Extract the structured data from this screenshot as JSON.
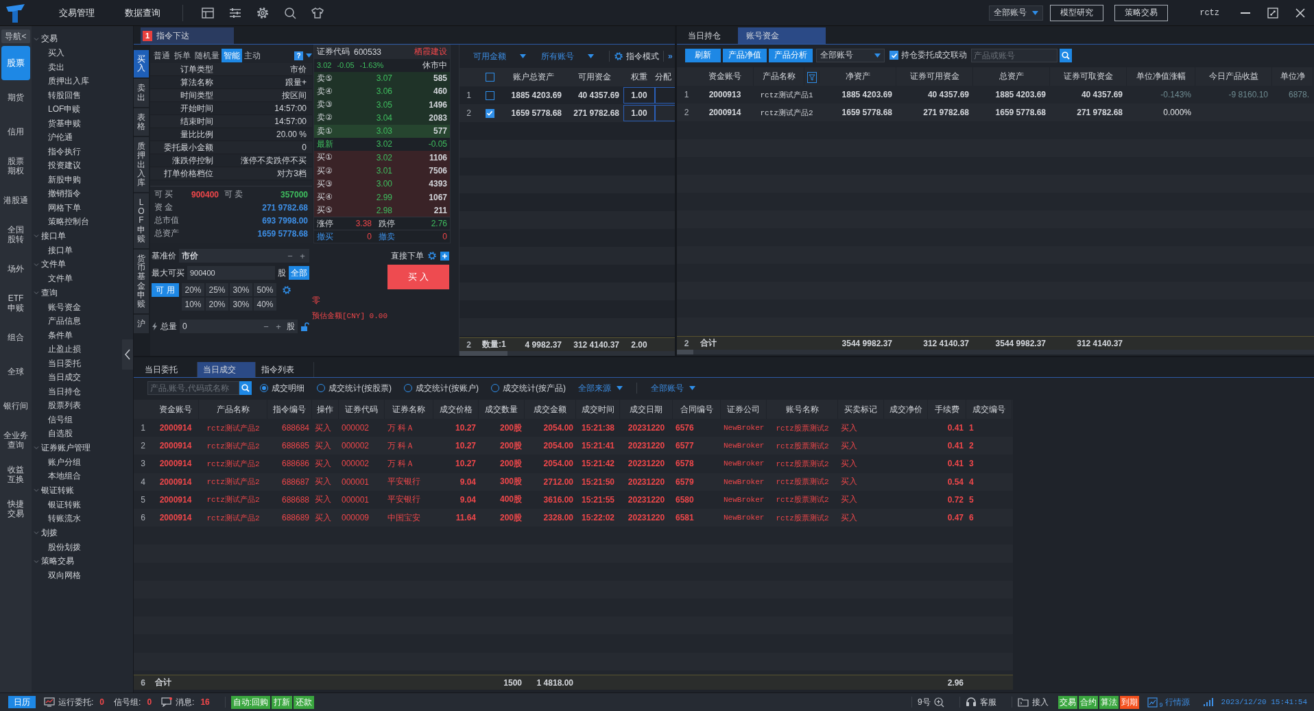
{
  "topbar": {
    "menus": [
      "交易管理",
      "数据查询"
    ],
    "account_filter": "全部账号",
    "buttons": [
      "模型研究",
      "策略交易"
    ],
    "user": "rctz"
  },
  "rail": {
    "toggle": "导航<",
    "items": [
      {
        "lines": [
          "股票"
        ],
        "selected": true
      },
      {
        "lines": [
          "期货"
        ],
        "selected": false
      },
      {
        "lines": [
          "信用"
        ],
        "selected": false
      },
      {
        "lines": [
          "股票",
          "期权"
        ],
        "selected": false
      },
      {
        "lines": [
          "港股通"
        ],
        "selected": false
      },
      {
        "lines": [
          "全国",
          "股转"
        ],
        "selected": false
      },
      {
        "lines": [
          "场外"
        ],
        "selected": false
      },
      {
        "lines": [
          "ETF",
          "申赎"
        ],
        "selected": false
      },
      {
        "lines": [
          "组合"
        ],
        "selected": false
      },
      {
        "lines": [
          "全球"
        ],
        "selected": false
      },
      {
        "lines": [
          "银行间"
        ],
        "selected": false
      },
      {
        "lines": [
          "全业务",
          "查询"
        ],
        "selected": false
      },
      {
        "lines": [
          "收益",
          "互换"
        ],
        "selected": false
      },
      {
        "lines": [
          "快捷",
          "交易"
        ],
        "selected": false
      }
    ]
  },
  "nav": {
    "groups": [
      {
        "label": "交易",
        "expanded": true,
        "children": [
          "买入",
          "卖出",
          "质押出入库",
          "转股回售",
          "LOF申赎",
          "货基申赎",
          "沪伦通",
          "指令执行",
          "投资建议",
          "新股申购",
          "撤销指令",
          "网格下单",
          "策略控制台"
        ]
      },
      {
        "label": "接口单",
        "expanded": true,
        "children": [
          "接口单"
        ]
      },
      {
        "label": "文件单",
        "expanded": true,
        "children": [
          "文件单"
        ]
      },
      {
        "label": "查询",
        "expanded": true,
        "children": [
          "账号资金",
          "产品信息",
          "条件单",
          "止盈止损",
          "当日委托",
          "当日成交",
          "当日持仓",
          "股票列表",
          "信号组",
          "自选股"
        ]
      },
      {
        "label": "证券账户管理",
        "expanded": true,
        "children": [
          "账户分组",
          "本地组合"
        ]
      },
      {
        "label": "银证转账",
        "expanded": true,
        "children": [
          "银证转账",
          "转账流水"
        ]
      },
      {
        "label": "划拨",
        "expanded": true,
        "children": [
          "股份划拨"
        ]
      },
      {
        "label": "策略交易",
        "expanded": true,
        "children": [
          "双向网格"
        ]
      }
    ]
  },
  "order": {
    "tab_badge": "1",
    "tab_title": "指令下达",
    "side_tabs": [
      {
        "label": "买入",
        "selected": true
      },
      {
        "label": "卖出",
        "selected": false
      },
      {
        "label": "表格",
        "selected": false
      },
      {
        "label": "质押出入库",
        "selected": false
      },
      {
        "label": "LOF申赎",
        "selected": false
      },
      {
        "label": "货币基金申赎",
        "selected": false
      },
      {
        "label": "沪",
        "selected": false
      }
    ],
    "mode_tabs": [
      {
        "label": "普通",
        "selected": false
      },
      {
        "label": "拆单",
        "selected": false
      },
      {
        "label": "随机量",
        "selected": false
      },
      {
        "label": "智能",
        "selected": true
      },
      {
        "label": "主动",
        "selected": false
      }
    ],
    "help": "?",
    "params": [
      {
        "label": "订单类型",
        "value": "市价"
      },
      {
        "label": "算法名称",
        "value": "跟量+"
      },
      {
        "label": "时间类型",
        "value": "按区间"
      },
      {
        "label": "开始时间",
        "value": "14:57:00"
      },
      {
        "label": "结束时间",
        "value": "14:57:00"
      },
      {
        "label": "量比比例",
        "value": "20.00 %"
      },
      {
        "label": "委托最小金额",
        "value": "0"
      },
      {
        "label": "涨跌停控制",
        "value": "涨停不卖跌停不买"
      },
      {
        "label": "打单价格档位",
        "value": "对方3档"
      }
    ],
    "can_buy": {
      "label": "可 买",
      "value": "900400"
    },
    "can_sell": {
      "label": "可 卖",
      "value": "357000"
    },
    "funds": [
      {
        "label": "资 金",
        "value": "271 9782.68"
      },
      {
        "label": "总市值",
        "value": "693 7998.00"
      },
      {
        "label": "总资产",
        "value": "1659 5778.68"
      }
    ],
    "quote": {
      "code_label": "证券代码",
      "code": "600533",
      "name": "栖霞建设",
      "price": "3.02",
      "change": "-0.05",
      "change_pct": "-1.63%",
      "status": "休市中",
      "asks": [
        {
          "label": "卖⑤",
          "price": "3.07",
          "volume": "585"
        },
        {
          "label": "卖④",
          "price": "3.06",
          "volume": "460"
        },
        {
          "label": "卖③",
          "price": "3.05",
          "volume": "1496"
        },
        {
          "label": "卖②",
          "price": "3.04",
          "volume": "2083"
        },
        {
          "label": "卖①",
          "price": "3.03",
          "volume": "577"
        }
      ],
      "last": {
        "label": "最新",
        "price": "3.02",
        "change": "-0.05"
      },
      "bids": [
        {
          "label": "买①",
          "price": "3.02",
          "volume": "1106"
        },
        {
          "label": "买②",
          "price": "3.01",
          "volume": "7506"
        },
        {
          "label": "买③",
          "price": "3.00",
          "volume": "4393"
        },
        {
          "label": "买④",
          "price": "2.99",
          "volume": "1067"
        },
        {
          "label": "买⑤",
          "price": "2.98",
          "volume": "211"
        }
      ],
      "limit_up": {
        "label": "涨停",
        "value": "3.38"
      },
      "limit_down": {
        "label": "跌停",
        "value": "2.76"
      },
      "cancel_buy": {
        "label": "撤买",
        "value": "0"
      },
      "cancel_sell": {
        "label": "撤卖",
        "value": "0"
      }
    },
    "base_price": {
      "label": "基准价",
      "value": "市价",
      "decrement": "−",
      "increment": "+"
    },
    "max_buy": {
      "label": "最大可买",
      "value": "900400",
      "unit": "股",
      "button": "全部"
    },
    "available": "可 用",
    "percents": [
      [
        "20%",
        "25%",
        "30%",
        "50%"
      ],
      [
        "10%",
        "20%",
        "30%",
        "40%"
      ]
    ],
    "total": {
      "label": "总量",
      "value": "0",
      "decrement": "−",
      "increment": "+",
      "unit": "股"
    },
    "direct_label": "直接下单",
    "submit": "买 入",
    "zero": "零",
    "estimate": "预估金额[CNY] 0.00"
  },
  "accounts": {
    "filters": [
      "可用金额",
      "所有账号"
    ],
    "mode": "指令模式",
    "more": "»",
    "all_checked": false,
    "columns": [
      "账户总资产",
      "可用资金",
      "权重",
      "分配"
    ],
    "rows": [
      {
        "index": "1",
        "checked": false,
        "total": "1885 4203.69",
        "available": "40 4357.69",
        "weight": "1.00"
      },
      {
        "index": "2",
        "checked": true,
        "total": "1659 5778.68",
        "available": "271 9782.68",
        "weight": "1.00"
      }
    ],
    "footer": {
      "index": "2",
      "label": "数量:1",
      "total": "4 9982.37",
      "available": "312 4140.37",
      "weight": "2.00"
    }
  },
  "funds": {
    "tabs": [
      {
        "label": "当日持仓",
        "selected": false
      },
      {
        "label": "账号资金",
        "selected": true
      }
    ],
    "buttons": [
      "刷新",
      "产品净值",
      "产品分析"
    ],
    "account_filter": "全部账号",
    "link": {
      "label": "持仓委托成交联动",
      "checked": true
    },
    "search_placeholder": "产品或账号",
    "columns": [
      "资金账号",
      "产品名称",
      "净资产",
      "证券可用资金",
      "总资产",
      "证券可取资金",
      "单位净值涨幅",
      "今日产品收益",
      "单位净"
    ],
    "rows": [
      {
        "index": "1",
        "color": "#6f8c92",
        "cells": [
          "2000913",
          "rctz测试产品1",
          "1885 4203.69",
          "40 4357.69",
          "1885 4203.69",
          "40 4357.69",
          "-0.143%",
          "-9 8160.10",
          "6878."
        ]
      },
      {
        "index": "2",
        "color": "#e6e8eb",
        "cells": [
          "2000914",
          "rctz测试产品2",
          "1659 5778.68",
          "271 9782.68",
          "1659 5778.68",
          "271 9782.68",
          "0.000%",
          null,
          null
        ]
      }
    ],
    "footer": {
      "index": "2",
      "cells": [
        "合计",
        null,
        "3544 9982.37",
        "312 4140.37",
        "3544 9982.37",
        "312 4140.37",
        null,
        null,
        null
      ]
    }
  },
  "trades": {
    "tabs": [
      {
        "label": "当日委托",
        "selected": false
      },
      {
        "label": "当日成交",
        "selected": true
      },
      {
        "label": "指令列表",
        "selected": false
      }
    ],
    "search_placeholder": "产品,账号,代码或名称",
    "radios": [
      {
        "label": "成交明细",
        "selected": true
      },
      {
        "label": "成交统计(按股票)",
        "selected": false
      },
      {
        "label": "成交统计(按账户)",
        "selected": false
      },
      {
        "label": "成交统计(按产品)",
        "selected": false
      }
    ],
    "dropdowns": [
      "全部来源",
      "全部账号"
    ],
    "columns": [
      "资金账号",
      "产品名称",
      "指令编号",
      "操作",
      "证券代码",
      "证券名称",
      "成交价格",
      "成交数量",
      "成交金额",
      "成交时间",
      "成交日期",
      "合同编号",
      "证券公司",
      "账号名称",
      "买卖标记",
      "成交净价",
      "手续费",
      "成交编号"
    ],
    "rows": [
      {
        "index": "1",
        "cells": [
          "2000914",
          "rctz测试产品2",
          "688684",
          "买入",
          "000002",
          "万 科Ａ",
          "10.27",
          "200股",
          "2054.00",
          "15:21:38",
          "20231220",
          "6576",
          "NewBroker",
          "rctz股票测试2",
          "买入",
          null,
          "0.41",
          "1"
        ]
      },
      {
        "index": "2",
        "cells": [
          "2000914",
          "rctz测试产品2",
          "688685",
          "买入",
          "000002",
          "万 科Ａ",
          "10.27",
          "200股",
          "2054.00",
          "15:21:41",
          "20231220",
          "6577",
          "NewBroker",
          "rctz股票测试2",
          "买入",
          null,
          "0.41",
          "2"
        ]
      },
      {
        "index": "3",
        "cells": [
          "2000914",
          "rctz测试产品2",
          "688686",
          "买入",
          "000002",
          "万 科Ａ",
          "10.27",
          "200股",
          "2054.00",
          "15:21:42",
          "20231220",
          "6578",
          "NewBroker",
          "rctz股票测试2",
          "买入",
          null,
          "0.41",
          "3"
        ]
      },
      {
        "index": "4",
        "cells": [
          "2000914",
          "rctz测试产品2",
          "688687",
          "买入",
          "000001",
          "平安银行",
          "9.04",
          "300股",
          "2712.00",
          "15:21:50",
          "20231220",
          "6579",
          "NewBroker",
          "rctz股票测试2",
          "买入",
          null,
          "0.54",
          "4"
        ]
      },
      {
        "index": "5",
        "cells": [
          "2000914",
          "rctz测试产品2",
          "688688",
          "买入",
          "000001",
          "平安银行",
          "9.04",
          "400股",
          "3616.00",
          "15:21:55",
          "20231220",
          "6580",
          "NewBroker",
          "rctz股票测试2",
          "买入",
          null,
          "0.72",
          "5"
        ]
      },
      {
        "index": "6",
        "cells": [
          "2000914",
          "rctz测试产品2",
          "688689",
          "买入",
          "000009",
          "中国宝安",
          "11.64",
          "200股",
          "2328.00",
          "15:22:02",
          "20231220",
          "6581",
          "NewBroker",
          "rctz股票测试2",
          "买入",
          null,
          "0.47",
          "6"
        ]
      }
    ],
    "footer": {
      "index": "6",
      "cells": [
        "合计",
        null,
        null,
        null,
        null,
        null,
        null,
        "1500",
        "1 4818.00",
        null,
        null,
        null,
        null,
        null,
        null,
        null,
        "2.96",
        null
      ]
    }
  },
  "status": {
    "calendar": "日历",
    "running": {
      "label": "运行委托:",
      "value": "0"
    },
    "signals": {
      "label": "信号组:",
      "value": "0"
    },
    "messages": {
      "label": "消息:",
      "value": "16"
    },
    "badges": [
      {
        "label": "自动:回购",
        "color": "#3aa63f"
      },
      {
        "label": "打新",
        "color": "#3aa63f"
      },
      {
        "label": "还款",
        "color": "#3aa63f"
      }
    ],
    "zoom": "9号",
    "service": "客服",
    "connect": "接入",
    "tags": [
      {
        "label": "交易",
        "color": "#3aa63f"
      },
      {
        "label": "合约",
        "color": "#3aa63f"
      },
      {
        "label": "算法",
        "color": "#3aa63f"
      },
      {
        "label": "到期",
        "color": "#f4511e"
      }
    ],
    "quote_count": "9",
    "quote_source": "行情源",
    "datetime": "2023/12/20 15:41:54"
  }
}
